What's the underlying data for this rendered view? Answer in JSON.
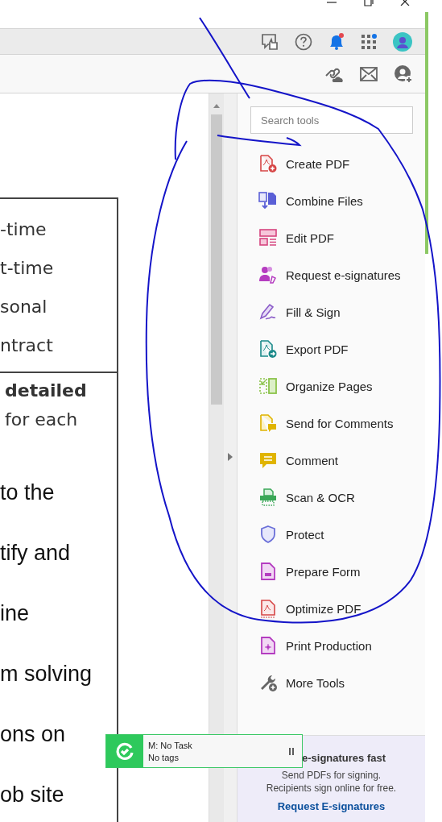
{
  "document": {
    "table_lines": [
      {
        "text": "-time",
        "bold": false
      },
      {
        "text": "t-time",
        "bold": false
      },
      {
        "text": "sonal",
        "bold": false
      },
      {
        "text": "ntract",
        "bold": false
      }
    ],
    "cell_lines": [
      {
        "text": "detailed",
        "bold": true
      },
      {
        "text": "for each",
        "bold": false
      }
    ],
    "body_lines": [
      "to the",
      "tify and",
      "ine",
      "m solving",
      "ons on",
      "ob site"
    ]
  },
  "tools_pane": {
    "search": {
      "placeholder": "Search tools"
    },
    "tools": [
      {
        "label": "Create PDF",
        "kind": "create"
      },
      {
        "label": "Combine Files",
        "kind": "combine"
      },
      {
        "label": "Edit PDF",
        "kind": "edit"
      },
      {
        "label": "Request e-signatures",
        "kind": "request"
      },
      {
        "label": "Fill & Sign",
        "kind": "fill"
      },
      {
        "label": "Export PDF",
        "kind": "export"
      },
      {
        "label": "Organize Pages",
        "kind": "organize"
      },
      {
        "label": "Send for Comments",
        "kind": "send"
      },
      {
        "label": "Comment",
        "kind": "comment"
      },
      {
        "label": "Scan & OCR",
        "kind": "scan"
      },
      {
        "label": "Protect",
        "kind": "protect"
      },
      {
        "label": "Prepare Form",
        "kind": "prepare"
      },
      {
        "label": "Optimize PDF",
        "kind": "optimize"
      },
      {
        "label": "Print Production",
        "kind": "print"
      },
      {
        "label": "More Tools",
        "kind": "more"
      }
    ],
    "promo": {
      "title": "e-signatures fast",
      "text": [
        "Send PDFs for signing.",
        "Recipients sign online for free."
      ],
      "link": "Request E-signatures"
    }
  },
  "timer_widget": {
    "task": "M: No Task",
    "tags": "No tags"
  }
}
